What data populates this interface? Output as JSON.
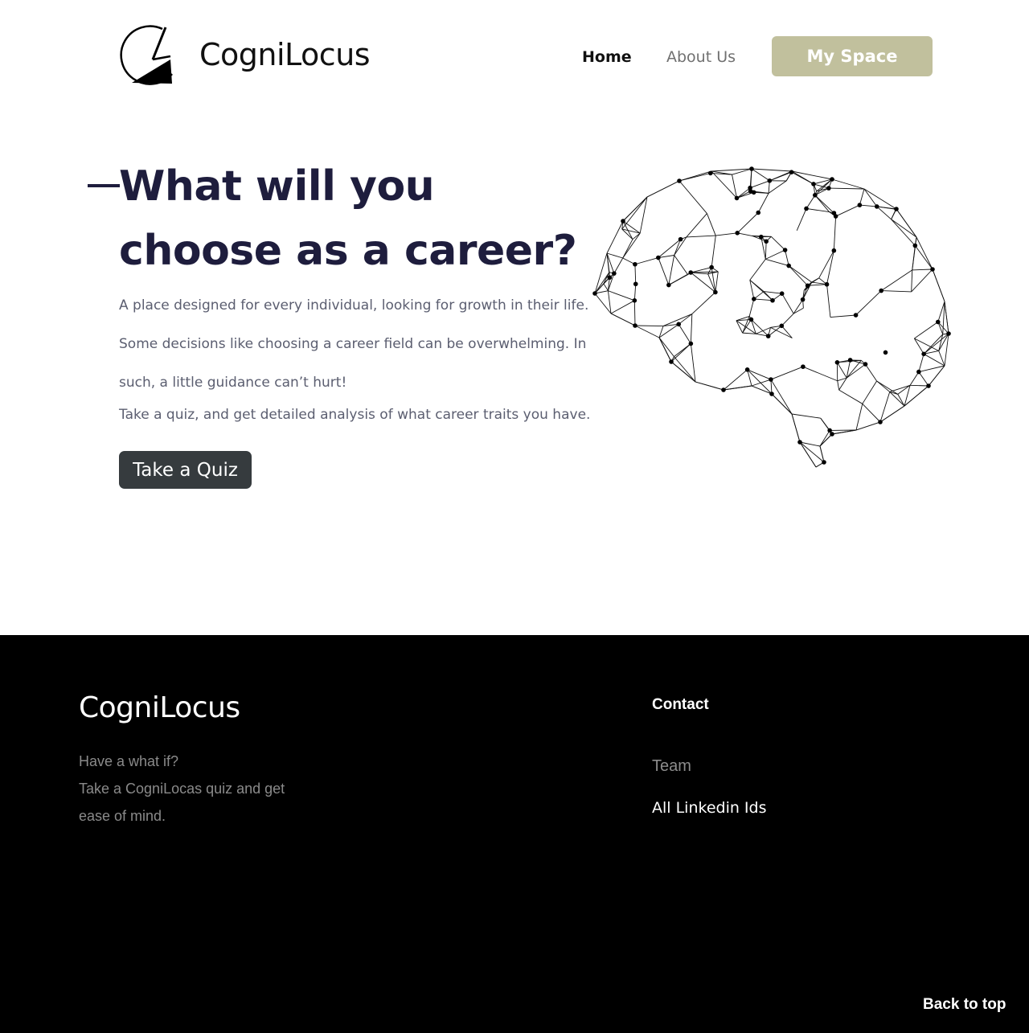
{
  "header": {
    "brand": "CogniLocus",
    "nav": {
      "home": "Home",
      "about": "About Us"
    },
    "cta": "My Space"
  },
  "hero": {
    "title": "What will you choose as a career?",
    "description": "A place designed for every individual, looking for growth in their life. Some decisions like choosing a career field can be overwhelming. In such, a little guidance can’t hurt!",
    "description2": "Take a quiz, and get detailed analysis of what career traits you have.",
    "button": "Take a Quiz",
    "image_icon": "brain-network-illustration"
  },
  "footer": {
    "brand": "CogniLocus",
    "tagline": [
      "Have a what if?",
      "Take a CogniLocas quiz and get",
      "ease of mind."
    ],
    "contact_heading": "Contact",
    "links": {
      "team": "Team",
      "linkedin": "All Linkedin Ids"
    },
    "back_to_top": "Back to top"
  },
  "colors": {
    "heading": "#1e1d3d",
    "body_text": "#5b5e70",
    "cta_bg": "#c1c09d",
    "quiz_button_bg": "#363b3e",
    "footer_bg": "#000000"
  }
}
